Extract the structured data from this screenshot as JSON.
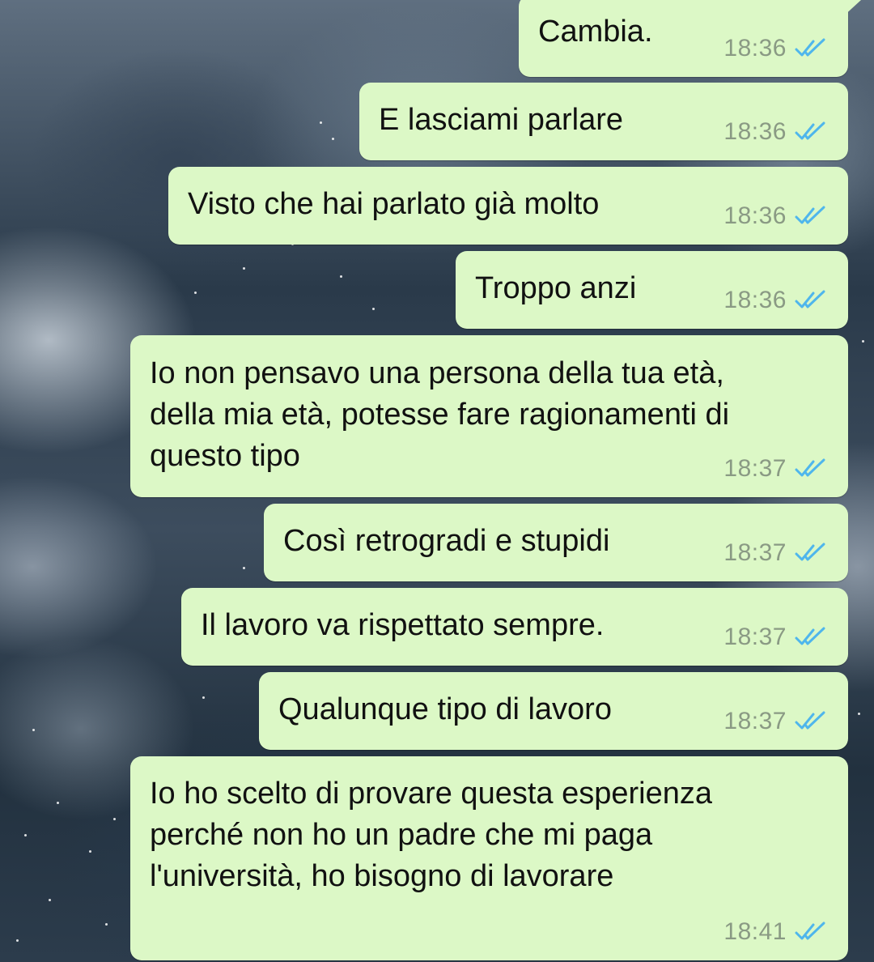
{
  "messages": [
    {
      "text": "Cambia.",
      "time": "18:36",
      "status": "read"
    },
    {
      "text": "E lasciami parlare",
      "time": "18:36",
      "status": "read"
    },
    {
      "text": "Visto che hai parlato già molto",
      "time": "18:36",
      "status": "read"
    },
    {
      "text": "Troppo anzi",
      "time": "18:36",
      "status": "read"
    },
    {
      "text": "Io non pensavo una persona della tua età,\ndella mia età, potesse fare ragionamenti di\nquesto tipo",
      "time": "18:37",
      "status": "read"
    },
    {
      "text": "Così retrogradi e stupidi",
      "time": "18:37",
      "status": "read"
    },
    {
      "text": "Il lavoro va rispettato sempre.",
      "time": "18:37",
      "status": "read"
    },
    {
      "text": "Qualunque tipo di lavoro",
      "time": "18:37",
      "status": "read"
    },
    {
      "text": "Io ho scelto di provare questa esperienza\nperché non ho un padre che mi paga\nl'università, ho bisogno di lavorare",
      "time": "18:41",
      "status": "read"
    }
  ],
  "colors": {
    "bubble_outgoing": "#dcf8c6",
    "timestamp": "#8a9a84",
    "read_check": "#4fb6ec"
  },
  "icons": {
    "read_receipt": "double-check-icon"
  }
}
